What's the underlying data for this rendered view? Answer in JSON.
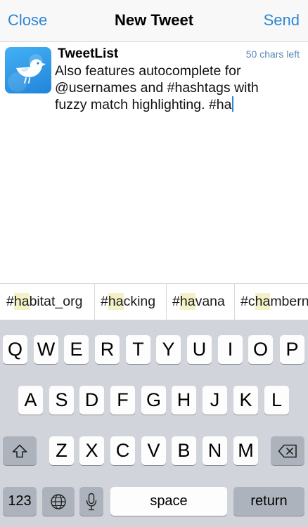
{
  "nav": {
    "close_label": "Close",
    "title": "New Tweet",
    "send_label": "Send"
  },
  "compose": {
    "account_name": "TweetList",
    "chars_left": "50 chars left",
    "text_line1": "Also features autocomplete for",
    "text_line2": "@usernames and #hashtags with",
    "text_line3": "fuzzy match highlighting. #ha",
    "avatar_icon": "bird-logo-icon"
  },
  "suggestions": [
    {
      "pre": "#",
      "hl": "ha",
      "post": "bitat_org"
    },
    {
      "pre": "#",
      "hl": "ha",
      "post": "cking"
    },
    {
      "pre": "#",
      "hl": "ha",
      "post": "vana"
    },
    {
      "pre": "#c",
      "hl": "ha",
      "post": "mbern"
    }
  ],
  "keyboard": {
    "row1": [
      "Q",
      "W",
      "E",
      "R",
      "T",
      "Y",
      "U",
      "I",
      "O",
      "P"
    ],
    "row2": [
      "A",
      "S",
      "D",
      "F",
      "G",
      "H",
      "J",
      "K",
      "L"
    ],
    "row3": [
      "Z",
      "X",
      "C",
      "V",
      "B",
      "N",
      "M"
    ],
    "numbers_label": "123",
    "space_label": "space",
    "return_label": "return",
    "icons": {
      "shift": "shift-icon",
      "delete": "delete-icon",
      "globe": "globe-icon",
      "mic": "microphone-icon"
    }
  },
  "colors": {
    "accent": "#2e86d4",
    "highlight": "#f4f1c6",
    "keyboard_bg": "#d1d5db",
    "special_key": "#adb3bc"
  }
}
